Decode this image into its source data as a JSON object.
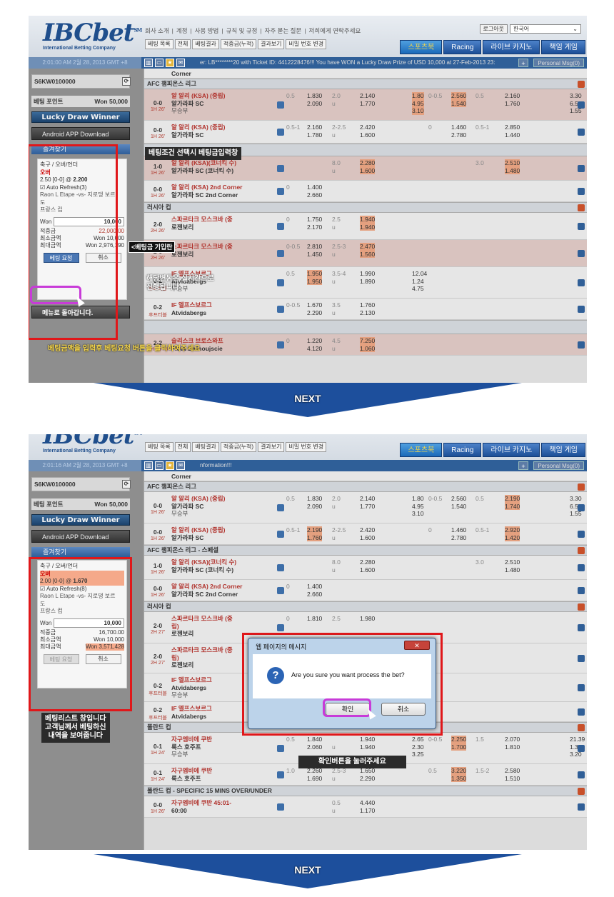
{
  "header": {
    "logo": "IBCbet",
    "logo_tm": "SM",
    "logo_sub": "International Betting Company",
    "top_links": [
      "회사 소개",
      "|",
      "계정",
      "|",
      "사용 방법",
      "|",
      "규칙 및 규정",
      "|",
      "자주 묻는 질문",
      "|",
      "저희에게 연락주세요"
    ],
    "logout": "로그아웃",
    "language": "한국어",
    "sub_tabs": [
      "베팅 목록",
      "전체",
      "베팅결과",
      "적중금(누적)",
      "결과보기",
      "비밀 번호 변경"
    ],
    "main_tabs": [
      "스포츠북",
      "Racing",
      "라이브 카지노",
      "책임 게임"
    ]
  },
  "screen1": {
    "clock": "2:01:00 AM 2월 28, 2013 GMT +8",
    "marquee": "er: LB********20 with Ticket ID: 4412228476!!! You have WON a Lucky Draw Prize of USD 10,000 at 27-Feb-2013 23:",
    "personal_msg": "Personal Msg(0)",
    "account": "S6KW0100000",
    "points_label": "베팅 포인트",
    "points_value": "Won 50,000",
    "lucky": "Lucky Draw Winner",
    "android": "Android APP Download",
    "favorites": "즐겨찾기",
    "slip": {
      "sport": "축구 / 오버/언더",
      "pick": "오버",
      "line": "2.50 [0-0] @",
      "odds": "2.200",
      "auto": "Auto Refresh(3)",
      "match": "Raon L Etape -vs- 지로댕 보르",
      "match2": "도",
      "league": "프랑스 컵",
      "won": "Won",
      "amount": "10,000",
      "k1": "적중금",
      "v1": "22,000.00",
      "k2": "최소금액",
      "v2": "Won 10,000",
      "k3": "최대금액",
      "v3": "Won 2,976,190",
      "bet": "베팅 요청",
      "cancel": "취소"
    },
    "back": "메뉴로 돌아갑니다.",
    "cap1": "베팅조건 선택시 베팅금입력창",
    "cap2": "<베팅금 기입란",
    "cap3": "해당변동은 실시간으로",
    "cap4": "진행됩니다",
    "cap5": "베팅금액을 입력후 베팅요청 버튼을 클릭하여주세요",
    "sec_corner": "Corner",
    "sec1": "AFC 챔피온스 리그",
    "sec2": "러시아 컵",
    "rows_a": [
      {
        "score": "0-0",
        "time": "1H 26'",
        "h": "알 알리 (KSA) (중립)",
        "a": "알가라파 SC",
        "d": "무승부",
        "l1": "0.5",
        "o1": "1.830",
        "o2": "2.090",
        "l2": "2.0",
        "u": "u",
        "o3": "2.140",
        "o4": "1.770",
        "o5": "1.80",
        "o6": "4.95",
        "o7": "3.10",
        "l3": "0-0.5",
        "o8": "2.560",
        "o9": "1.540",
        "l4": "0.5",
        "o10": "2.160",
        "o11": "1.760",
        "o12": "3.30",
        "o13": "6.59",
        "o14": "1.55"
      },
      {
        "score": "0-0",
        "time": "1H 26'",
        "h": "알 알리 (KSA) (중립)",
        "a": "알가라파 SC",
        "l1": "0.5-1",
        "o1": "2.160",
        "o2": "1.780",
        "l2": "2-2.5",
        "u": "u",
        "o3": "2.420",
        "o4": "1.600",
        "l3": "0",
        "o8": "1.460",
        "o9": "2.780",
        "l4": "0.5-1",
        "o10": "2.850",
        "o11": "1.440"
      }
    ],
    "rows_b": [
      {
        "score": "1-0",
        "time": "1H 26'",
        "h": "알 알리 (KSA)(코너킥 수)",
        "a": "알가라파 SC (코너킥 수)",
        "l2": "8.0",
        "u": "u",
        "o3": "2.280",
        "o4": "1.600",
        "l4": "3.0",
        "o10": "2.510",
        "o11": "1.480"
      },
      {
        "score": "0-0",
        "time": "1H 26'",
        "h": "알 알리 (KSA) 2nd Corner",
        "a": "알가라파 SC 2nd Corner",
        "l1": "0",
        "o1": "1.400",
        "o2": "2.660"
      }
    ],
    "rows_c": [
      {
        "score": "2-0",
        "time": "2H 26'",
        "h": "스파르타크 모스크바 (중",
        "a": "로젠보리",
        "l1": "0",
        "o1": "1.750",
        "o2": "2.170",
        "l2": "2.5",
        "u": "u",
        "o3": "1.940",
        "o4": "1.940"
      },
      {
        "score": "2-0",
        "time": "2H 26'",
        "h": "스파르타크 모스크바 (중",
        "a": "로젠보리",
        "l1": "0-0.5",
        "o1": "2.810",
        "o2": "1.450",
        "l2": "2.5-3",
        "u": "u",
        "o3": "2.470",
        "o4": "1.560"
      },
      {
        "score": "0-2",
        "time": "후프터블",
        "h": "IF 엘프스보르그",
        "a": "Atvidabergs",
        "d": "무승부",
        "l1": "0.5",
        "o1": "1.950",
        "o2": "1.950",
        "l2": "3.5-4",
        "u": "u",
        "o3": "1.990",
        "o4": "1.890",
        "o5": "12.04",
        "o6": "1.24",
        "o7": "4.75"
      },
      {
        "score": "0-2",
        "time": "후프터블",
        "h": "IF 엘프스보르그",
        "a": "Atvidabergs",
        "l1": "0-0.5",
        "o1": "1.670",
        "o2": "2.290",
        "l2": "3.5",
        "u": "u",
        "o3": "1.760",
        "o4": "2.130"
      },
      {
        "score": "2-2",
        "time": "2H 48'+3",
        "h": "슬리스크 브로스와프",
        "a": "Flota Swinoujscie",
        "l1": "0",
        "o1": "1.220",
        "o2": "4.120",
        "l2": "4.5",
        "u": "u",
        "o3": "7.250",
        "o4": "1.060"
      }
    ]
  },
  "screen2": {
    "clock": "2:01:16 AM 2월 28, 2013 GMT +8",
    "marquee": "nformation!!!",
    "personal_msg": "Personal Msg(0)",
    "account": "S6KW0100000",
    "points_label": "베팅 포인트",
    "points_value": "Won 50,000",
    "lucky": "Lucky Draw Winner",
    "android": "Android APP Download",
    "favorites": "즐겨찾기",
    "slip": {
      "sport": "축구 / 오버/언더",
      "pick": "오버",
      "line": "2.00 [0-0] @",
      "odds": "1.670",
      "auto": "Auto Refresh(8)",
      "match": "Raon L Etape -vs- 지로댕 보르",
      "match2": "도",
      "league": "프랑스 컵",
      "won": "Won",
      "amount": "10,000",
      "k1": "적중금",
      "v1": "16,700.00",
      "k2": "최소금액",
      "v2": "Won 10,000",
      "k3": "최대금액",
      "v3": "Won 3,571,428",
      "bet": "베팅 요청",
      "cancel": "취소"
    },
    "cap1": "베팅리스트 창입니다",
    "cap2": "고객님께서 베팅하신",
    "cap3": "내역을 보여줍니다",
    "cap4": "확인버튼을 눌러주세요",
    "sec_corner": "Corner",
    "sec1": "AFC 챔피온스 리그",
    "sec1b": "AFC 챔피온스 리그 - 스페셜",
    "sec2": "러시아 컵",
    "sec3": "폴란드 컵",
    "sec4": "폴란드 컵 - SPECIFIC 15 MINS OVER/UNDER",
    "rows_a": [
      {
        "score": "0-0",
        "time": "1H 26'",
        "h": "알 알리 (KSA) (중립)",
        "a": "알가라파 SC",
        "d": "무승부",
        "l1": "0.5",
        "o1": "1.830",
        "o2": "2.090",
        "l2": "2.0",
        "u": "u",
        "o3": "2.140",
        "o4": "1.770",
        "o5": "1.80",
        "o6": "4.95",
        "o7": "3.10",
        "l3": "0-0.5",
        "o8": "2.560",
        "o9": "1.540",
        "l4": "0.5",
        "o10": "2.190",
        "o11": "1.740",
        "o12": "3.30",
        "o13": "6.59",
        "o14": "1.55"
      },
      {
        "score": "0-0",
        "time": "1H 26'",
        "h": "알 알리 (KSA) (중립)",
        "a": "알가라파 SC",
        "l1": "0.5-1",
        "o1": "2.190",
        "o2": "1.760",
        "l2": "2-2.5",
        "u": "u",
        "o3": "2.420",
        "o4": "1.600",
        "l3": "0",
        "o8": "1.460",
        "o9": "2.780",
        "l4": "0.5-1",
        "o10": "2.920",
        "o11": "1.420"
      }
    ],
    "rows_b": [
      {
        "score": "1-0",
        "time": "1H 26'",
        "h": "알 알리 (KSA)(코너킥 수)",
        "a": "알가라파 SC (코너킥 수)",
        "l2": "8.0",
        "u": "u",
        "o3": "2.280",
        "o4": "1.600",
        "l4": "3.0",
        "o10": "2.510",
        "o11": "1.480"
      },
      {
        "score": "0-0",
        "time": "1H 26'",
        "h": "알 알리 (KSA) 2nd Corner",
        "a": "알가라파 SC 2nd Corner",
        "l1": "0",
        "o1": "1.400",
        "o2": "2.660"
      }
    ],
    "rows_c": [
      {
        "score": "2-0",
        "time": "2H 27'",
        "h": "스파르타크 모스크바 (중",
        "h2": "립)",
        "a": "로젠보리",
        "l1": "0",
        "o1": "1.810",
        "o2": "",
        "l2": "2.5",
        "o3": "1.980"
      },
      {
        "score": "2-0",
        "time": "2H 27'",
        "h": "스파르타크 모스크바 (중",
        "h2": "립)",
        "a": "로젠보리",
        "l1": "",
        "o1": "",
        "o2": "",
        "o3": ""
      },
      {
        "score": "0-2",
        "time": "후프터블",
        "h": "IF 엘프스보르그",
        "a": "Atvidabergs",
        "d": "무승부"
      },
      {
        "score": "0-2",
        "time": "후프터블",
        "h": "IF 엘프스보르그",
        "a": "Atvidabergs",
        "o2": "2.290",
        "o4": "2.130"
      }
    ],
    "rows_d": [
      {
        "score": "0-1",
        "time": "1H 24'",
        "h": "자구엠비에 쿠반",
        "a": "룩스 호주프",
        "d": "무승부",
        "l1": "0.5",
        "o1": "1.840",
        "o2": "2.060",
        "l2": "",
        "u": "u",
        "o3": "1.940",
        "o4": "1.940",
        "o5": "2.65",
        "o6": "2.30",
        "o7": "3.25",
        "l3": "0-0.5",
        "o8": "2.250",
        "o9": "1.700",
        "l4": "1.5",
        "o10": "2.070",
        "o11": "1.810",
        "o12": "21.39",
        "o13": "1.35",
        "o14": "3.20"
      },
      {
        "score": "0-1",
        "time": "1H 24'",
        "h": "자구엠비에 쿠반",
        "a": "룩스 호주프",
        "l1": "1.0",
        "o1": "2.260",
        "o2": "1.690",
        "l2": "2.5-3",
        "u": "u",
        "o3": "1.650",
        "o4": "2.290",
        "l3": "0.5",
        "o8": "3.220",
        "o9": "1.350",
        "l4": "1.5-2",
        "o10": "2.580",
        "o11": "1.510"
      }
    ],
    "row_e": {
      "score": "0-0",
      "time": "1H 26'",
      "h": "자구엠비에 쿠반 45:01-",
      "a": "60:00",
      "l2": "0.5",
      "u": "u",
      "o3": "4.440",
      "o4": "1.170"
    },
    "dialog": {
      "title": "웹 페이지의 메시지",
      "message": "Are you sure you want process the bet?",
      "ok": "확인",
      "cancel": "취소"
    }
  },
  "next_label": "NEXT",
  "colors": {
    "accent_red": "#e0171a",
    "purple": "#c83bd8",
    "nav_blue": "#1d4f9c"
  }
}
